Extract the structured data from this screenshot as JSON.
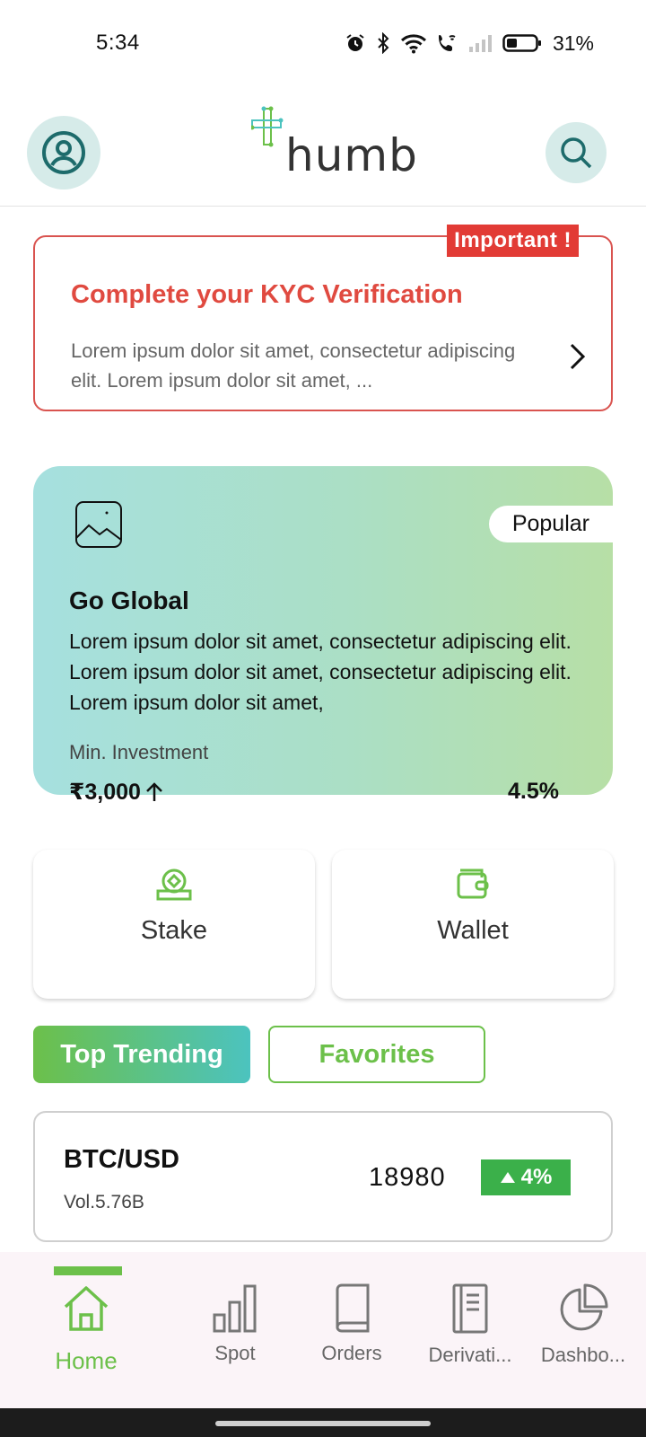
{
  "status_bar": {
    "time": "5:34",
    "battery_percent": "31%",
    "icons": [
      "alarm-icon",
      "bluetooth-icon",
      "wifi-icon",
      "wifi-calling-icon",
      "signal-icon",
      "battery-icon"
    ]
  },
  "header": {
    "logo_text": "humb",
    "profile_icon": "profile-icon",
    "search_icon": "search-icon",
    "accent_bg": "#d6ebe9"
  },
  "kyc": {
    "badge": "Important !",
    "title": "Complete your KYC Verification",
    "description": "Lorem ipsum dolor sit amet, consectetur adipiscing elit. Lorem ipsum dolor sit amet, ...",
    "color": "#e04a40"
  },
  "promo": {
    "badge": "Popular",
    "title": "Go Global",
    "description": "Lorem ipsum dolor sit amet, consectetur adipiscing elit. Lorem ipsum dolor sit amet, consectetur adipiscing elit. Lorem ipsum dolor sit amet,",
    "min_label": "Min. Investment",
    "min_amount": "₹3,000",
    "rate": "4.5%"
  },
  "actions": {
    "stake_label": "Stake",
    "wallet_label": "Wallet"
  },
  "tabs": {
    "trending_label": "Top Trending",
    "favorites_label": "Favorites"
  },
  "market": {
    "pair": "BTC/USD",
    "volume": "Vol.5.76B",
    "price": "18980",
    "change": "4%",
    "change_color": "#3bb04a"
  },
  "bottom_nav": {
    "items": [
      {
        "label": "Home",
        "icon": "home-icon"
      },
      {
        "label": "Spot",
        "icon": "bar-chart-icon"
      },
      {
        "label": "Orders",
        "icon": "book-icon"
      },
      {
        "label": "Derivati...",
        "icon": "notebook-icon"
      },
      {
        "label": "Dashbo...",
        "icon": "pie-chart-icon"
      }
    ],
    "active_color": "#6cc04a"
  }
}
